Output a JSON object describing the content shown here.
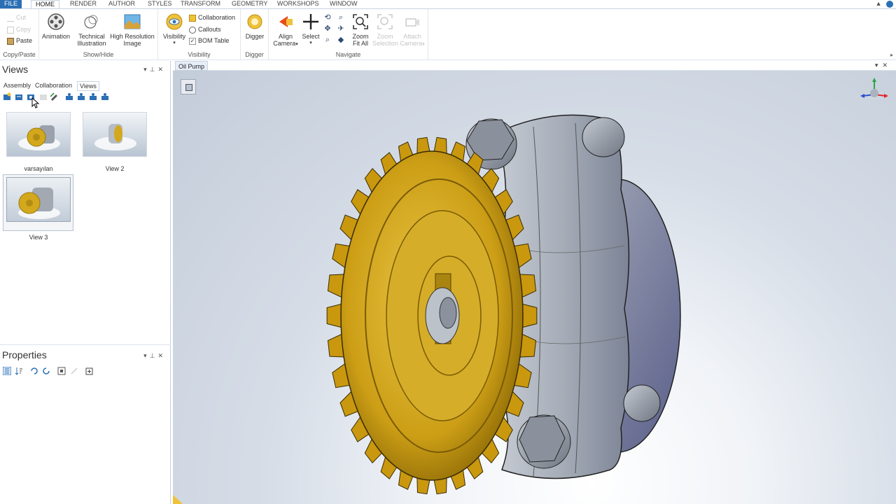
{
  "menu": {
    "tabs": [
      "FILE",
      "HOME",
      "RENDER",
      "AUTHOR",
      "STYLES",
      "TRANSFORM",
      "GEOMETRY",
      "WORKSHOPS",
      "WINDOW"
    ],
    "active": "HOME"
  },
  "ribbon": {
    "copy_paste": {
      "cut": "Cut",
      "copy": "Copy",
      "paste": "Paste",
      "label": "Copy/Paste"
    },
    "show_hide": {
      "animation": "Animation",
      "technical_1": "Technical",
      "technical_2": "Illustration",
      "hires_1": "High Resolution",
      "hires_2": "Image",
      "label": "Show/Hide"
    },
    "visibility": {
      "visibility": "Visibility",
      "collaboration": "Collaboration",
      "callouts": "Callouts",
      "bom_table": "BOM Table",
      "label": "Visibility"
    },
    "digger": {
      "digger": "Digger",
      "label": "Digger"
    },
    "navigate": {
      "align_1": "Align",
      "align_2": "Camera",
      "select": "Select",
      "zoom_1": "Zoom",
      "zoom_2": "Fit All",
      "zoomsel_1": "Zoom",
      "zoomsel_2": "Selection",
      "attach_1": "Attach",
      "attach_2": "Camera",
      "label": "Navigate"
    }
  },
  "views_pane": {
    "title": "Views",
    "tabs": [
      "Assembly",
      "Collaboration",
      "Views"
    ],
    "active_tab": "Views",
    "views": [
      {
        "label": "varsayılan"
      },
      {
        "label": "View 2"
      },
      {
        "label": "View 3"
      }
    ]
  },
  "properties_pane": {
    "title": "Properties"
  },
  "document": {
    "tab": "Oil Pump"
  },
  "colors": {
    "accent": "#2b6fb4",
    "gear": "#d4a81c",
    "housing": "#9ea4ae"
  }
}
